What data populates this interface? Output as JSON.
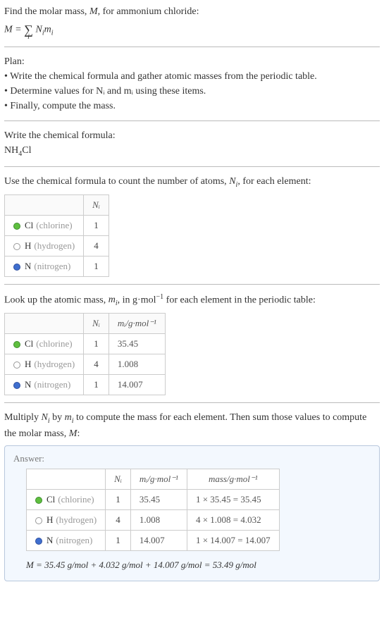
{
  "intro": {
    "line1_a": "Find the molar mass, ",
    "line1_M": "M",
    "line1_b": ", for ammonium chloride:",
    "eq_lhs": "M",
    "eq_eq": " = ",
    "eq_idx": "i",
    "eq_Ni": "N",
    "eq_i": "i",
    "eq_mi": "m",
    "eq_i2": "i"
  },
  "plan": {
    "heading": "Plan:",
    "items": [
      "Write the chemical formula and gather atomic masses from the periodic table.",
      "Determine values for Nᵢ and mᵢ using these items.",
      "Finally, compute the mass."
    ]
  },
  "formula_step": {
    "heading": "Write the chemical formula:",
    "formula_nh": "NH",
    "formula_4": "4",
    "formula_cl": "Cl"
  },
  "count_step": {
    "text_a": "Use the chemical formula to count the number of atoms, ",
    "Ni": "N",
    "i": "i",
    "text_b": ", for each element:",
    "header_Ni": "Nᵢ",
    "rows": [
      {
        "swatch": "sw-cl",
        "sym": "Cl",
        "name": "(chlorine)",
        "Ni": "1"
      },
      {
        "swatch": "sw-h",
        "sym": "H",
        "name": "(hydrogen)",
        "Ni": "4"
      },
      {
        "swatch": "sw-n",
        "sym": "N",
        "name": "(nitrogen)",
        "Ni": "1"
      }
    ]
  },
  "mass_step": {
    "text_a": "Look up the atomic mass, ",
    "mi": "m",
    "i": "i",
    "text_b": ", in g·mol",
    "exp": "−1",
    "text_c": " for each element in the periodic table:",
    "header_Ni": "Nᵢ",
    "header_mi": "mᵢ/g·mol⁻¹",
    "rows": [
      {
        "swatch": "sw-cl",
        "sym": "Cl",
        "name": "(chlorine)",
        "Ni": "1",
        "mi": "35.45"
      },
      {
        "swatch": "sw-h",
        "sym": "H",
        "name": "(hydrogen)",
        "Ni": "4",
        "mi": "1.008"
      },
      {
        "swatch": "sw-n",
        "sym": "N",
        "name": "(nitrogen)",
        "Ni": "1",
        "mi": "14.007"
      }
    ]
  },
  "compute_step": {
    "text_a": "Multiply ",
    "N": "N",
    "i1": "i",
    "text_b": " by ",
    "m": "m",
    "i2": "i",
    "text_c": " to compute the mass for each element. Then sum those values to compute the molar mass, ",
    "M": "M",
    "text_d": ":"
  },
  "answer": {
    "label": "Answer:",
    "header_Ni": "Nᵢ",
    "header_mi": "mᵢ/g·mol⁻¹",
    "header_mass": "mass/g·mol⁻¹",
    "rows": [
      {
        "swatch": "sw-cl",
        "sym": "Cl",
        "name": "(chlorine)",
        "Ni": "1",
        "mi": "35.45",
        "mass": "1 × 35.45 = 35.45"
      },
      {
        "swatch": "sw-h",
        "sym": "H",
        "name": "(hydrogen)",
        "Ni": "4",
        "mi": "1.008",
        "mass": "4 × 1.008 = 4.032"
      },
      {
        "swatch": "sw-n",
        "sym": "N",
        "name": "(nitrogen)",
        "Ni": "1",
        "mi": "14.007",
        "mass": "1 × 14.007 = 14.007"
      }
    ],
    "eq": "M = 35.45 g/mol + 4.032 g/mol + 14.007 g/mol = 53.49 g/mol"
  }
}
